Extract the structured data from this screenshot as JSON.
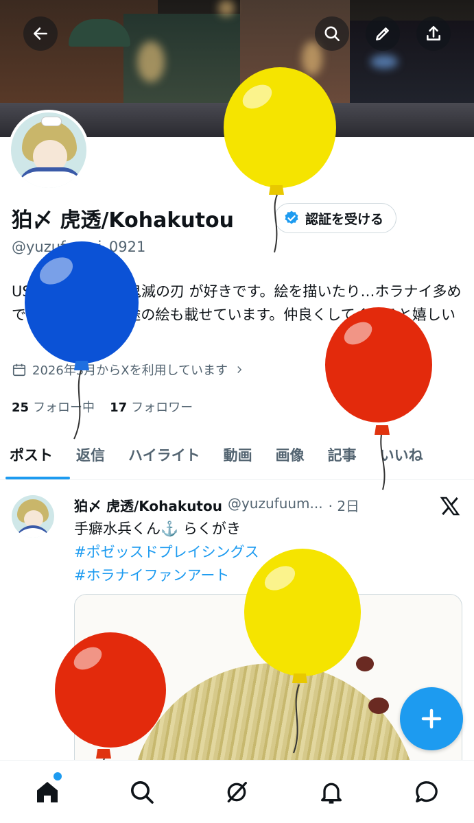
{
  "header": {
    "back_icon": "arrow-left-icon",
    "search_icon": "search-icon",
    "edit_icon": "pencil-icon",
    "share_icon": "share-icon"
  },
  "profile": {
    "name": "狛〆 虎透/Kohakutou",
    "handle": "@yuzufuumi_0921",
    "verify_label": "認証を受ける",
    "bio": "USJのお水兵くん/鬼滅の刃 が好きです。絵を描いたり…ホラナイ多めですがたまに他用途の絵も載せています。仲良くしてくれると嬉しい",
    "joined": "2026年3月からXを利用しています",
    "following_count": "25",
    "following_label": "フォロー中",
    "followers_count": "17",
    "followers_label": "フォロワー"
  },
  "tabs": [
    {
      "label": "ポスト"
    },
    {
      "label": "返信"
    },
    {
      "label": "ハイライト"
    },
    {
      "label": "動画"
    },
    {
      "label": "画像"
    },
    {
      "label": "記事"
    },
    {
      "label": "いいね"
    }
  ],
  "tweet": {
    "name": "狛〆 虎透/Kohakutou",
    "handle": "@yuzufuum...",
    "time": "· 2日",
    "text": "手癖水兵くん⚓️ らくがき",
    "hashtag1": "#ポゼッスドプレイシングス",
    "hashtag2": "#ホラナイファンアート"
  },
  "colors": {
    "accent": "#1d9bf0",
    "balloon_yellow": "#f5e400",
    "balloon_blue": "#0b52d6",
    "balloon_red": "#e32a0c"
  },
  "nav": {
    "home_icon": "home-icon",
    "search_icon": "search-icon",
    "grok_icon": "grok-icon",
    "notifications_icon": "bell-icon",
    "messages_icon": "messages-icon"
  }
}
